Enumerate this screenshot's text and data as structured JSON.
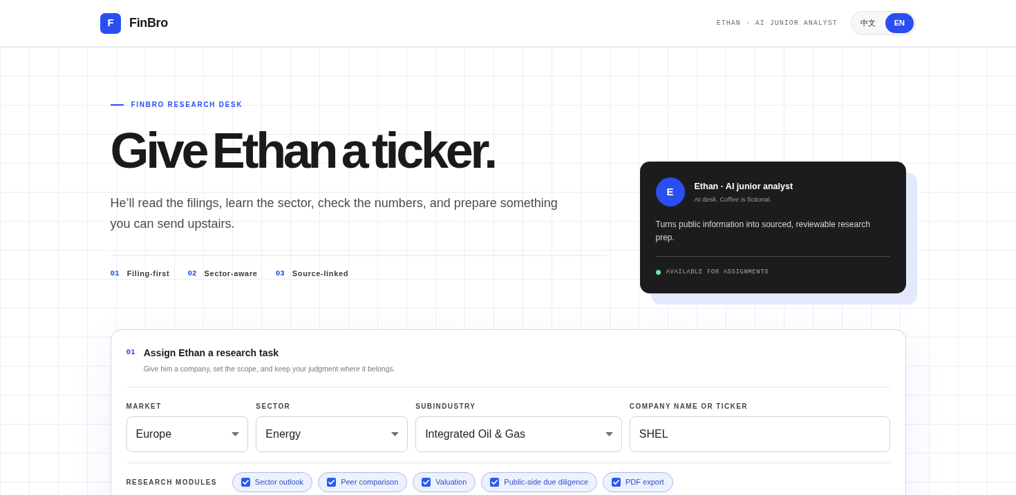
{
  "header": {
    "logo_letter": "F",
    "brand": "FinBro",
    "tagline": "ETHAN · AI JUNIOR ANALYST",
    "languages": [
      {
        "label": "中文",
        "selected": false
      },
      {
        "label": "EN",
        "selected": true
      }
    ]
  },
  "hero": {
    "eyebrow": "FINBRO RESEARCH DESK",
    "title": "Give Ethan a ticker.",
    "subtitle": "He’ll read the filings, learn the sector, check the numbers, and prepare something you can send upstairs.",
    "features": [
      {
        "number": "01",
        "label": "Filing-first"
      },
      {
        "number": "02",
        "label": "Sector-aware"
      },
      {
        "number": "03",
        "label": "Source-linked"
      }
    ]
  },
  "profile_card": {
    "avatar_letter": "E",
    "name": "Ethan · AI junior analyst",
    "status_line": "At desk. Coffee is fictional.",
    "description": "Turns public information into sourced, reviewable research prep.",
    "availability": "AVAILABLE FOR ASSIGNMENTS"
  },
  "task_form": {
    "step": "01",
    "title": "Assign Ethan a research task",
    "subtitle": "Give him a company, set the scope, and keep your judgment where it belongs.",
    "fields": [
      {
        "kind": "select",
        "label": "MARKET",
        "value": "Europe"
      },
      {
        "kind": "select",
        "label": "SECTOR",
        "value": "Energy"
      },
      {
        "kind": "select",
        "label": "SUBINDUSTRY",
        "value": "Integrated Oil & Gas"
      },
      {
        "kind": "text",
        "label": "COMPANY NAME OR TICKER",
        "value": "SHEL"
      }
    ],
    "modules_label": "RESEARCH MODULES",
    "modules": [
      {
        "label": "Sector outlook",
        "checked": true
      },
      {
        "label": "Peer comparison",
        "checked": true
      },
      {
        "label": "Valuation",
        "checked": true
      },
      {
        "label": "Public-side due diligence",
        "checked": true
      },
      {
        "label": "PDF export",
        "checked": true
      }
    ]
  }
}
